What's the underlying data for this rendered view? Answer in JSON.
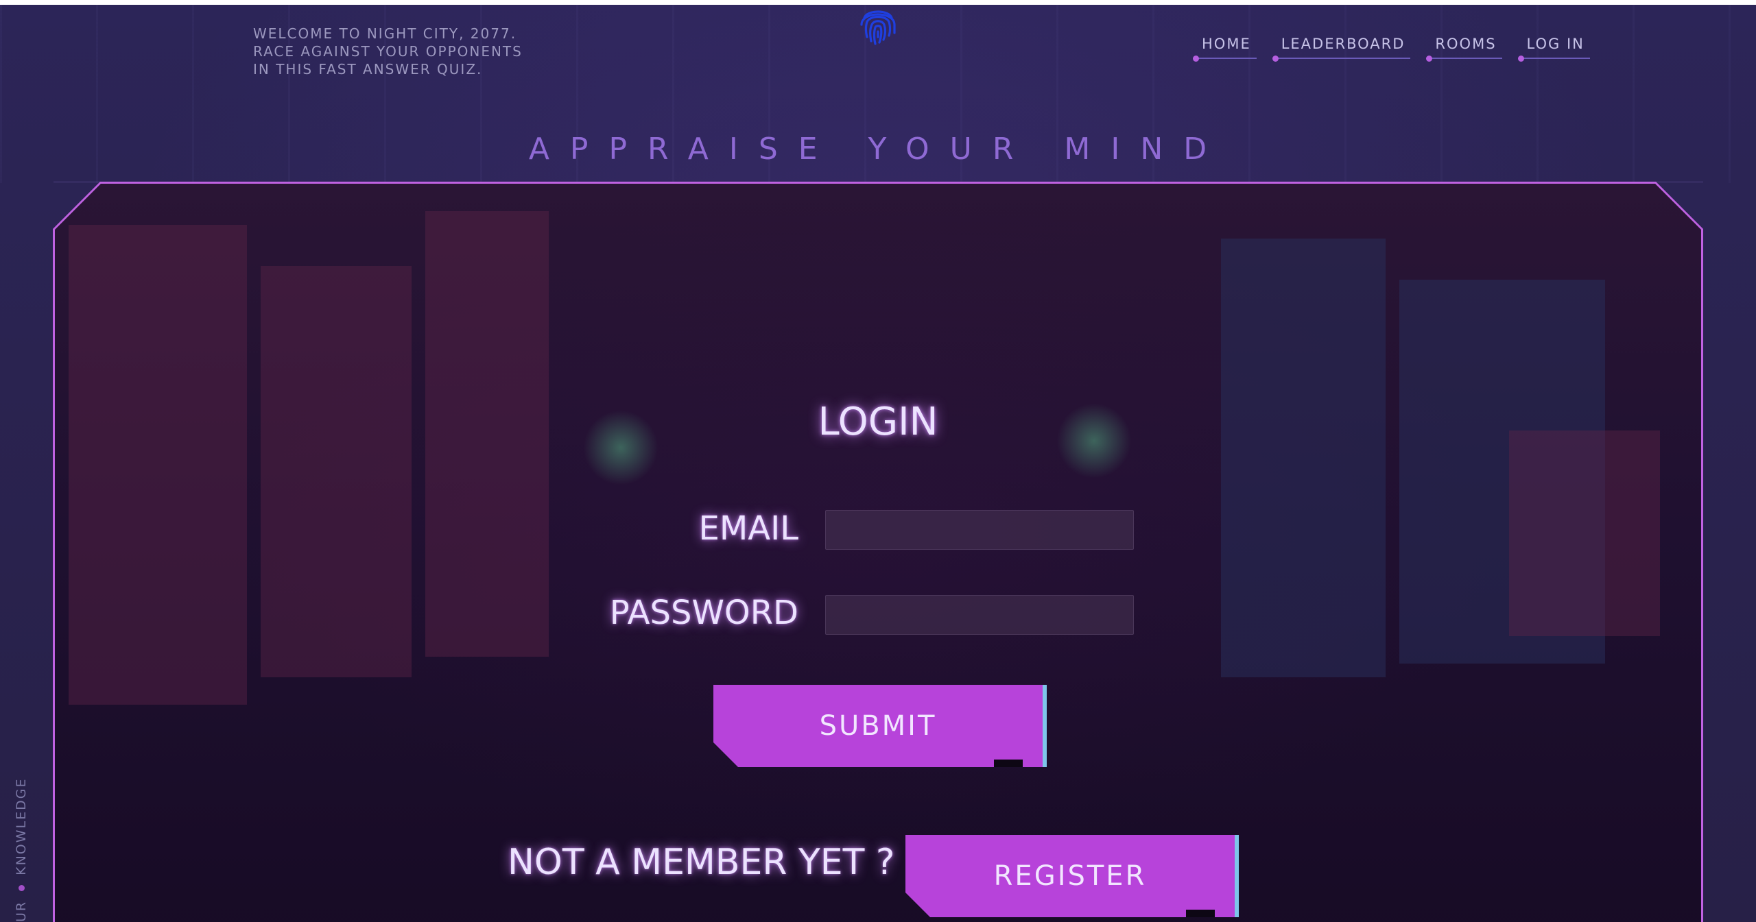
{
  "intro": {
    "lines": [
      "WELCOME TO NIGHT CITY, 2077.",
      "RACE AGAINST YOUR OPPONENTS",
      "IN THIS FAST ANSWER QUIZ."
    ]
  },
  "logo": {
    "icon": "fingerprint-icon",
    "color": "#1f3fe0"
  },
  "nav": {
    "items": [
      {
        "label": "HOME"
      },
      {
        "label": "LEADERBOARD"
      },
      {
        "label": "ROOMS"
      },
      {
        "label": "LOG IN"
      }
    ]
  },
  "tagline": "APPRAISE YOUR MIND",
  "login": {
    "title": "LOGIN",
    "email_label": "EMAIL",
    "email_value": "",
    "password_label": "PASSWORD",
    "password_value": "",
    "submit_label": "SUBMIT"
  },
  "register": {
    "prompt": "NOT A MEMBER YET ?",
    "button_label": "REGISTER"
  },
  "side_text": {
    "first": "UR",
    "second": "KNOWLEDGE"
  },
  "colors": {
    "accent": "#b743da",
    "frame": "#c062e2",
    "button_edge": "#7ec6ea",
    "background": "#2b2450"
  }
}
